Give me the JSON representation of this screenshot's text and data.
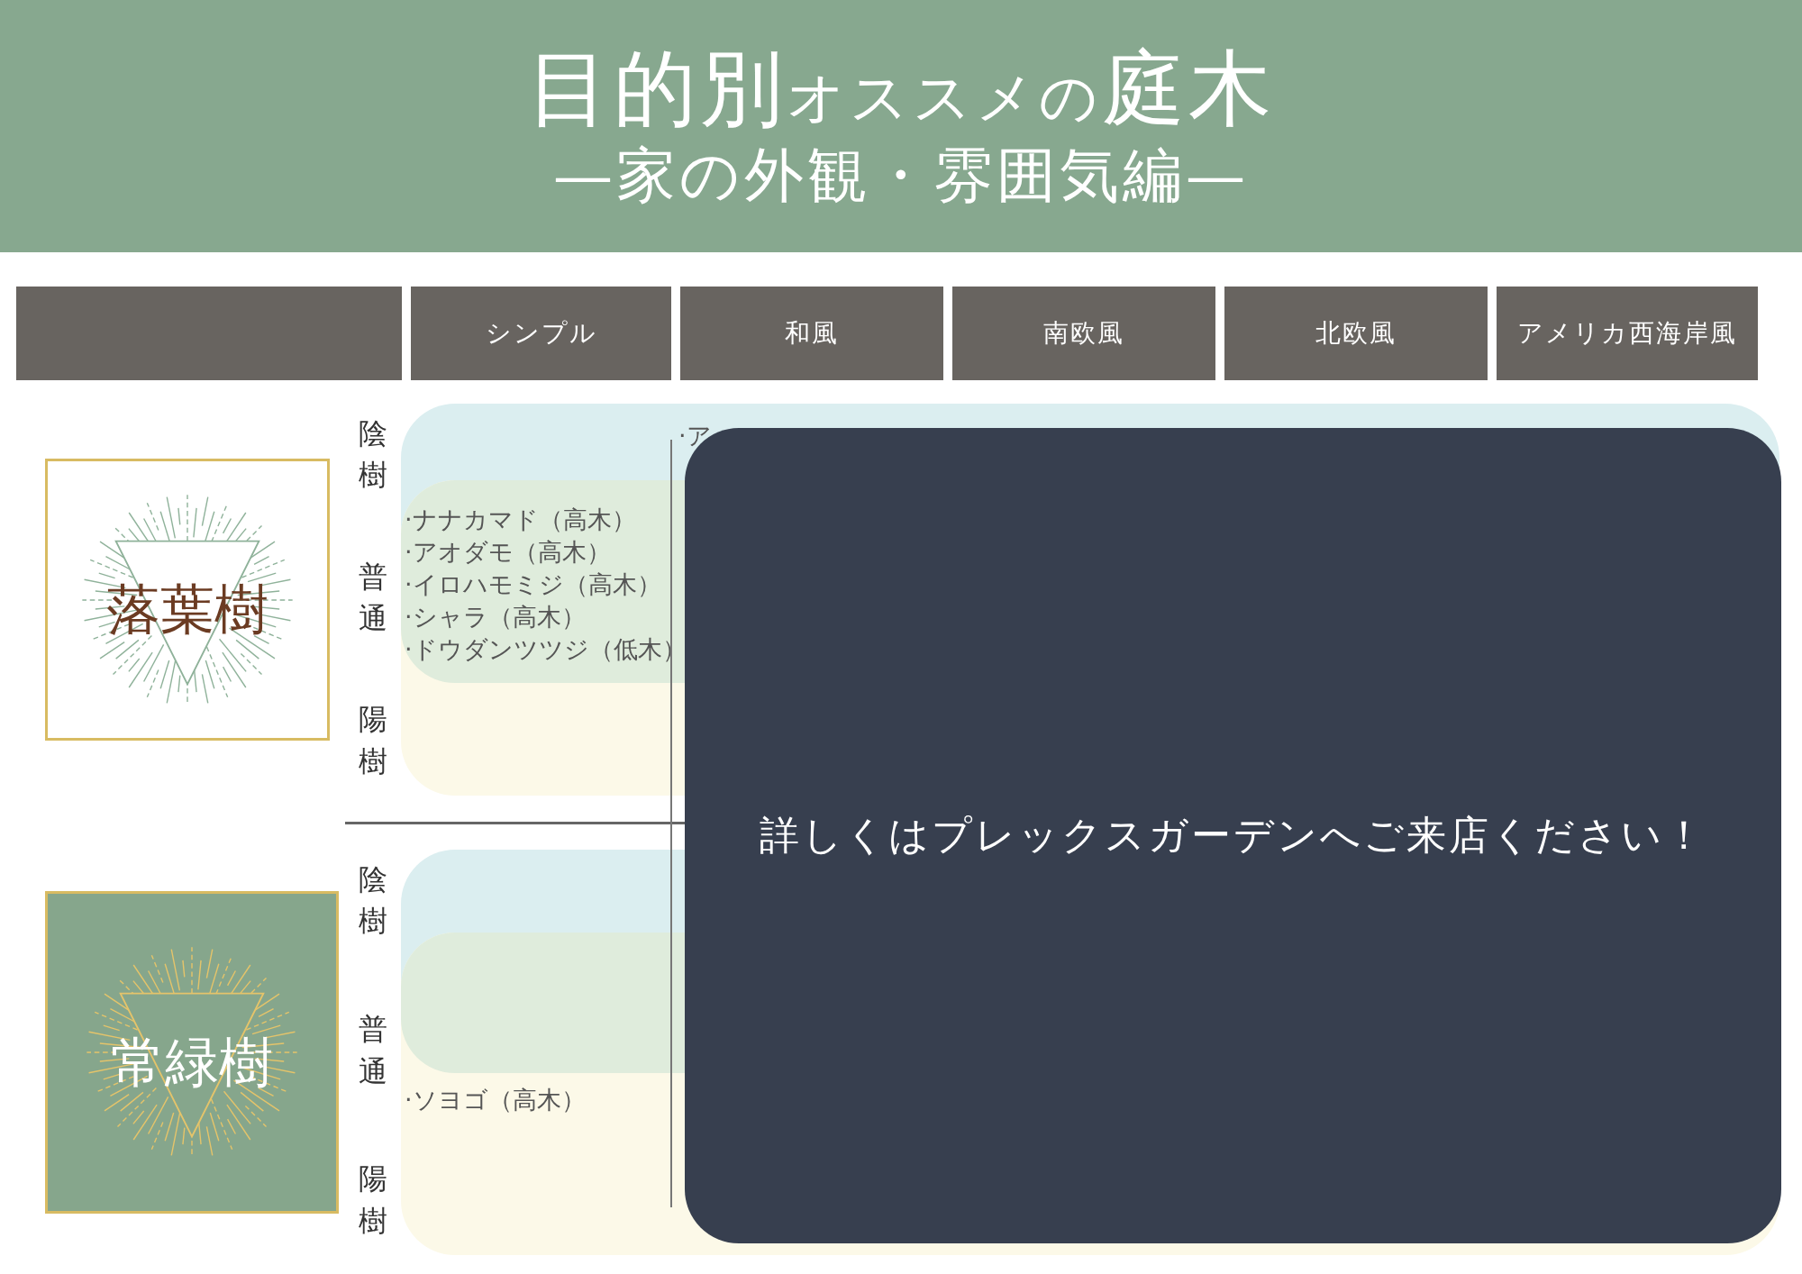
{
  "header": {
    "title": [
      "目的別",
      "オススメの",
      "庭木"
    ],
    "subtitle": "—家の外観・雰囲気編—"
  },
  "columns": [
    "シンプル",
    "和風",
    "南欧風",
    "北欧風",
    "アメリカ西海岸風"
  ],
  "sections": [
    {
      "category": "落葉樹",
      "kind": "outline",
      "levels": [
        "陰樹",
        "普通",
        "陽樹"
      ],
      "bands": [
        {
          "kind": "shade",
          "covered": "·ア"
        },
        {
          "kind": "normal",
          "items": [
            "·ナナカマド（高木）",
            "·アオダモ（高木）",
            "·イロハモミジ（高木）",
            "·シャラ（高木）",
            "·ドウダンツツジ（低木）"
          ]
        },
        {
          "kind": "sun"
        }
      ]
    },
    {
      "category": "常緑樹",
      "kind": "filled",
      "levels": [
        "陰樹",
        "普通",
        "陽樹"
      ],
      "bands": [
        {
          "kind": "shade"
        },
        {
          "kind": "normal"
        },
        {
          "kind": "sun",
          "items": [
            "·ソヨゴ（高木）"
          ]
        }
      ]
    }
  ],
  "overlay": {
    "message": "詳しくはプレックスガーデンへご来店ください！"
  }
}
